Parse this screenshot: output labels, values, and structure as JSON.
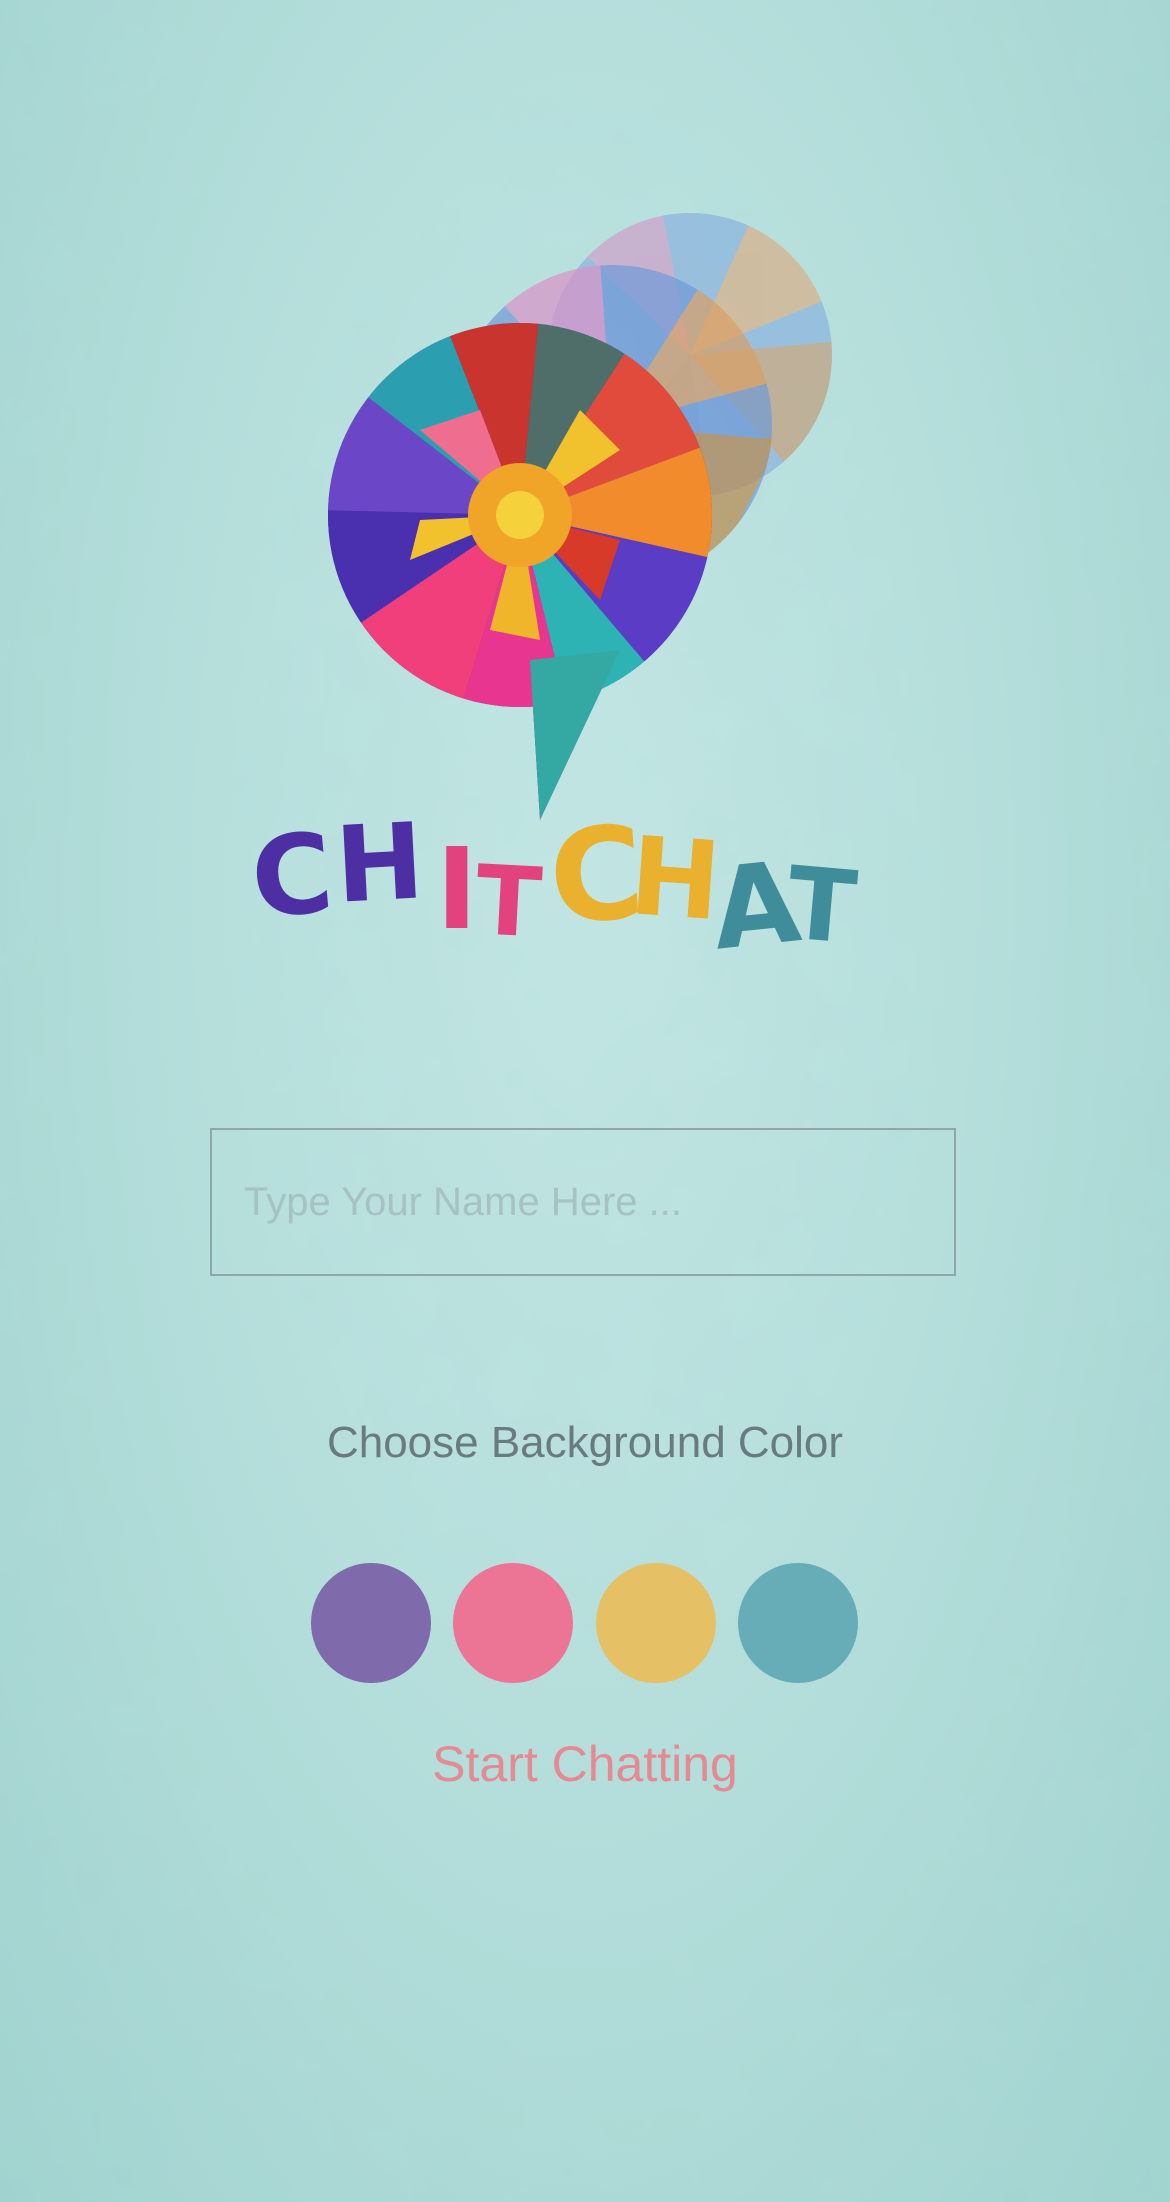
{
  "logo": {
    "wordmark": "CHITCHAT",
    "letters": [
      {
        "char": "C",
        "color": "#4d2ea3"
      },
      {
        "char": "H",
        "color": "#4d2ea3"
      },
      {
        "char": "I",
        "color": "#e2427e"
      },
      {
        "char": "T",
        "color": "#e2427e"
      },
      {
        "char": "C",
        "color": "#e9b12d"
      },
      {
        "char": "H",
        "color": "#e9b12d"
      },
      {
        "char": "A",
        "color": "#3f8d9b"
      },
      {
        "char": "T",
        "color": "#3f8d9b"
      }
    ]
  },
  "name_input": {
    "placeholder": "Type Your Name Here ...",
    "value": ""
  },
  "color_picker": {
    "label": "Choose Background Color",
    "options": [
      {
        "name": "purple",
        "color": "#7f6aac"
      },
      {
        "name": "pink",
        "color": "#ec7596"
      },
      {
        "name": "yellow",
        "color": "#e6c065"
      },
      {
        "name": "teal",
        "color": "#67adb7"
      }
    ]
  },
  "start_button": {
    "label": "Start Chatting",
    "color": "#e48a92"
  }
}
